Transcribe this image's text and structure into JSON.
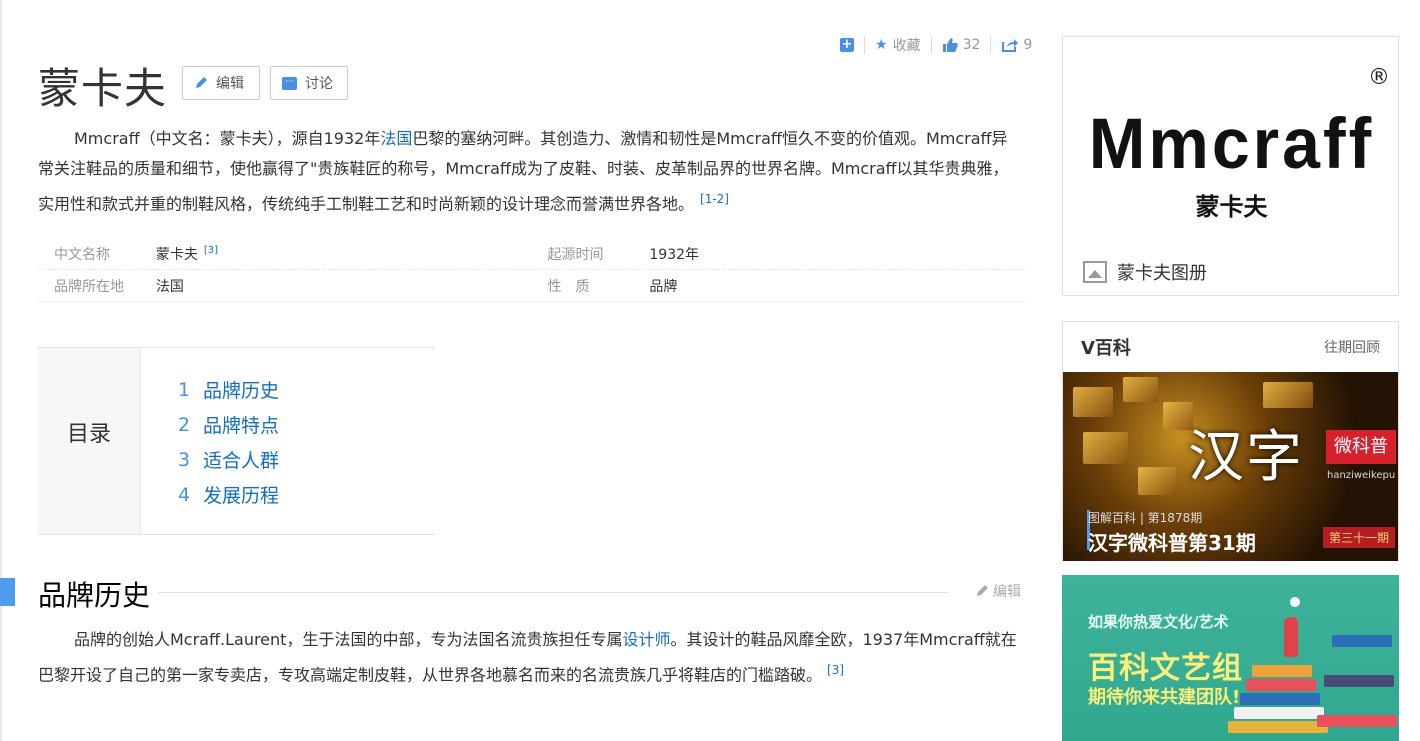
{
  "toolbar": {
    "collect_label": "收藏",
    "like_count": "32",
    "share_count": "9"
  },
  "title": "蒙卡夫",
  "actions": {
    "edit_label": "编辑",
    "discuss_label": "讨论"
  },
  "summary": {
    "part1": "Mmcraff（中文名：蒙卡夫），源自1932年",
    "link1": "法国",
    "part2": "巴黎的塞纳河畔。其创造力、激情和韧性是Mmcraff恒久不变的价值观。Mmcraff异常关注鞋品的质量和细节，使他赢得了\"贵族鞋匠的称号，Mmcraff成为了皮鞋、时装、皮革制品界的世界名牌。Mmcraff以其华贵典雅，实用性和款式并重的制鞋风格，传统纯手工制鞋工艺和时尚新颖的设计理念而誉满世界各地。",
    "ref": "[1-2]"
  },
  "basic_info": {
    "rows": [
      {
        "name1": "中文名称",
        "value1": "蒙卡夫",
        "ref1": "[3]",
        "name2": "起源时间",
        "value2": "1932年"
      },
      {
        "name1": "品牌所在地",
        "value1": "法国",
        "ref1": "",
        "name2": "性　质",
        "value2": "品牌"
      }
    ]
  },
  "catalog": {
    "heading": "目录",
    "items": [
      {
        "num": "1",
        "label": "品牌历史"
      },
      {
        "num": "2",
        "label": "品牌特点"
      },
      {
        "num": "3",
        "label": "适合人群"
      },
      {
        "num": "4",
        "label": "发展历程"
      }
    ]
  },
  "section": {
    "title": "品牌历史",
    "edit_label": "编辑",
    "text_part1": "品牌的创始人Mcraff.Laurent，生于法国的中部，专为法国名流贵族担任专属",
    "text_link": "设计师",
    "text_part2": "。其设计的鞋品风靡全欧，1937年Mmcraff就在巴黎开设了自己的第一家专卖店，专攻高端定制皮鞋，从世界各地慕名而来的名流贵族几乎将鞋店的门槛踏破。",
    "ref": "[3]"
  },
  "sidebar": {
    "logo_text": "Mmcraff",
    "logo_registered": "®",
    "logo_cn": "蒙卡夫",
    "album_label": "蒙卡夫图册",
    "v_title": "V百科",
    "v_more": "往期回顾",
    "v_big_text": "汉字",
    "v_badge": "微科普",
    "v_badge_sub": "hanziweikepu",
    "v_caption_small": "图解百科 | 第1878期",
    "v_caption_large": "汉字微科普第31期",
    "v_tag": "第三十一期",
    "art_line1": "如果你热爱文化/艺术",
    "art_line2": "百科文艺组",
    "art_line3": "期待你来共建团队!"
  },
  "colors": {
    "link": "#136ec2",
    "accent": "#4a90e2",
    "section_bar": "#4f9cee",
    "badge_red": "#d6212d",
    "art_bg": "#3fb39a"
  }
}
